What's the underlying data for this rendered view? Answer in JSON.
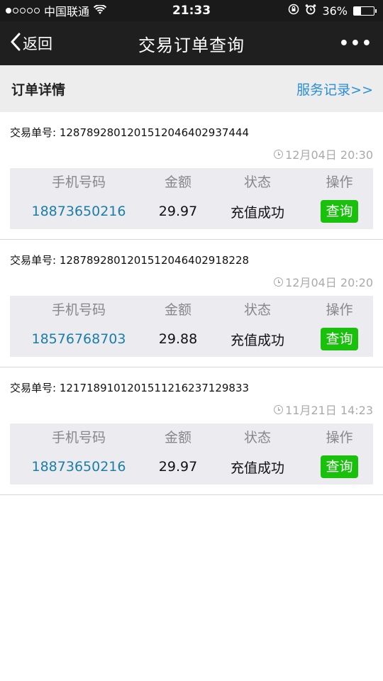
{
  "statusbar": {
    "carrier": "中国联通",
    "time": "21:33",
    "battery": "36%",
    "battery_level": 0.36,
    "signal_filled": 1,
    "signal_total": 5
  },
  "navbar": {
    "back_label": "返回",
    "title": "交易订单查询",
    "more_label": "•••"
  },
  "section": {
    "title": "订单详情",
    "records_link": "服务记录>>"
  },
  "table_headers": {
    "phone": "手机号码",
    "amount": "金额",
    "status": "状态",
    "action": "操作"
  },
  "orders": [
    {
      "order_label": "交易单号: 128789280120151204640293​7444",
      "time": "12月04日 20:30",
      "phone": "18873650216",
      "amount": "29.97",
      "status": "充值成功",
      "action": "查询"
    },
    {
      "order_label": "交易单号: 1287892801201512046402918228",
      "time": "12月04日 20:20",
      "phone": "18576768703",
      "amount": "29.88",
      "status": "充值成功",
      "action": "查询"
    },
    {
      "order_label": "交易单号: 1217189101201511216237129833",
      "time": "11月21日 14:23",
      "phone": "18873650216",
      "amount": "29.97",
      "status": "充值成功",
      "action": "查询"
    }
  ],
  "colors": {
    "accent_link": "#2a8fd8",
    "phone_text": "#1a7ea8",
    "query_button": "#19c10d",
    "navbar": "#1f1f1f"
  }
}
